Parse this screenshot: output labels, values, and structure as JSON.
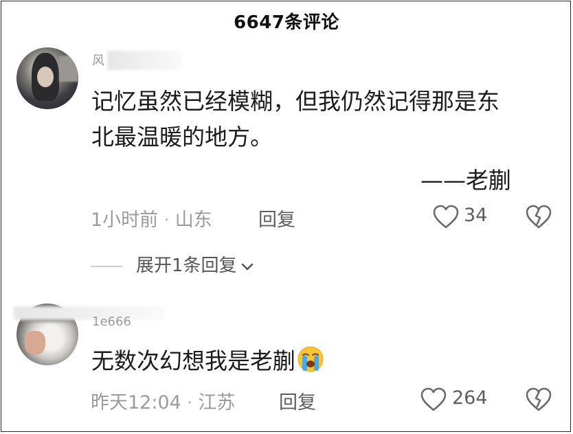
{
  "header": {
    "title": "6647条评论"
  },
  "comments": [
    {
      "username_visible": "风",
      "text": "记忆虽然已经模糊，但我仍然记得那是东北最温暖的地方。",
      "line1": "记忆虽然已经模糊，但我仍然记得那是东",
      "line2": "北最温暖的地方。",
      "attribution": "——老蒯",
      "time": "1小时前",
      "location": "山东",
      "reply_label": "回复",
      "likes": "34",
      "expand_label": "展开1条回复"
    },
    {
      "username_visible": "1e666",
      "text": "无数次幻想我是老蒯",
      "emoji": "crying-face-emoji",
      "time": "昨天12:04",
      "location": "江苏",
      "reply_label": "回复",
      "likes": "264"
    }
  ],
  "icons": [
    "heart-outline-icon",
    "broken-heart-icon",
    "chevron-down-icon"
  ],
  "colors": {
    "text": "#1c1c1c",
    "meta": "#9b9b9b",
    "icon": "#6a6a6a"
  }
}
